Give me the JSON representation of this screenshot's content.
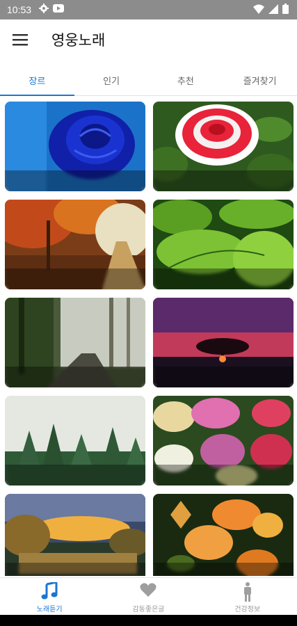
{
  "status_bar": {
    "time": "10:53",
    "icons": [
      "gear-icon",
      "youtube-icon",
      "wifi-icon",
      "signal-icon",
      "battery-icon"
    ]
  },
  "app_bar": {
    "title": "영웅노래",
    "menu_icon": "hamburger-menu-icon"
  },
  "tabs": [
    {
      "label": "장르",
      "active": true
    },
    {
      "label": "인기",
      "active": false
    },
    {
      "label": "추천",
      "active": false
    },
    {
      "label": "즐겨찾기",
      "active": false
    }
  ],
  "cards": [
    {
      "label": "",
      "scene": "blue-rose"
    },
    {
      "label": "",
      "scene": "red-white-rose"
    },
    {
      "label": "",
      "scene": "autumn-forest-path"
    },
    {
      "label": "",
      "scene": "green-leaves-dew"
    },
    {
      "label": "",
      "scene": "misty-forest-road"
    },
    {
      "label": "",
      "scene": "sunset-tree"
    },
    {
      "label": "",
      "scene": "foggy-pine-forest"
    },
    {
      "label": "",
      "scene": "yarrow-flowers"
    },
    {
      "label": "",
      "scene": "lake-sunset"
    },
    {
      "label": "",
      "scene": "orange-flowers-butterfly"
    }
  ],
  "bottom_nav": [
    {
      "label": "노래듣기",
      "icon": "music-note-icon",
      "active": true
    },
    {
      "label": "감동좋은글",
      "icon": "heart-icon",
      "active": false
    },
    {
      "label": "건강정보",
      "icon": "person-icon",
      "active": false
    }
  ],
  "colors": {
    "accent": "#1976d2",
    "status_bar": "#8c8c8c",
    "inactive": "#999999"
  }
}
